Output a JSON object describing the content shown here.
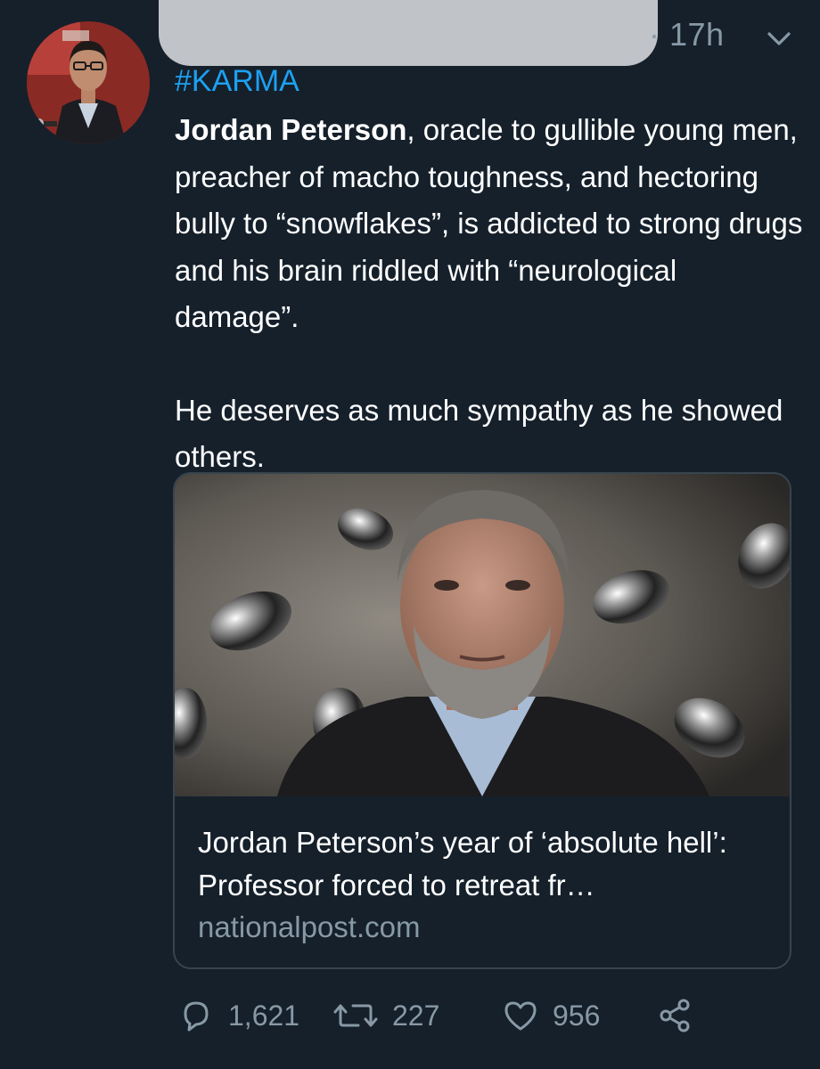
{
  "tweet": {
    "timestamp": "· 17h",
    "hashtag": "#KARMA",
    "text_bold": "Jordan Peterson",
    "text_line1_rest": ", oracle to gullible young men, preacher of macho toughness, and hectoring bully to “snowflakes”, is addicted to strong drugs and his brain riddled with “neurological damage”.",
    "text_paragraph2": "He deserves as much sympathy as he showed others."
  },
  "card": {
    "title": "Jordan Peterson’s year of ‘absolute hell’: Professor forced to retreat fr…",
    "domain": "nationalpost.com"
  },
  "actions": {
    "replies": "1,621",
    "retweets": "227",
    "likes": "956"
  },
  "icons": {
    "reply": "reply-icon",
    "retweet": "retweet-icon",
    "like": "heart-icon",
    "share": "share-icon",
    "more": "chevron-down-icon"
  },
  "colors": {
    "background": "#15202b",
    "link": "#1da1f2",
    "secondary_text": "#8899a6",
    "card_border": "#38444d"
  }
}
